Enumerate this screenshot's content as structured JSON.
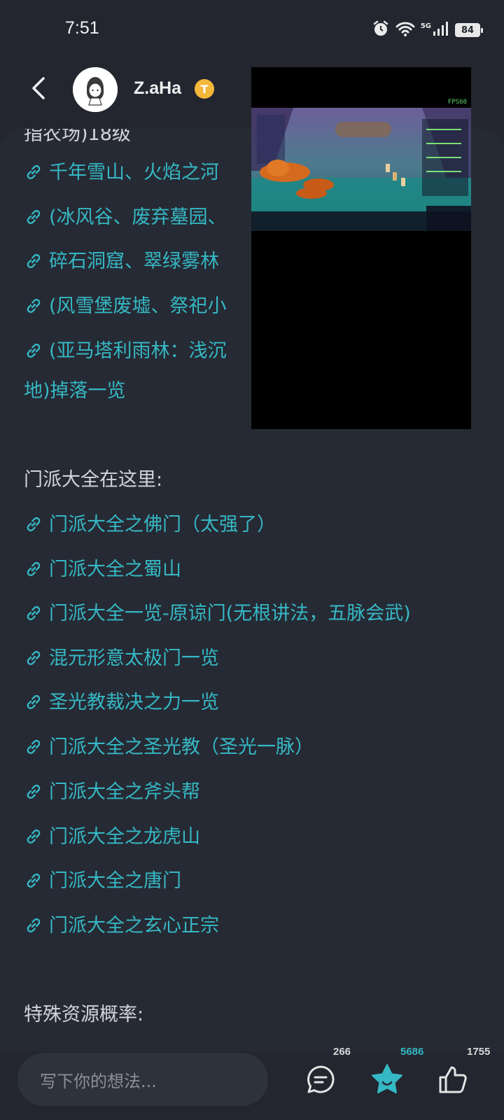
{
  "status": {
    "time": "7:51",
    "network": "5G",
    "battery": "84"
  },
  "header": {
    "username": "Z.aHa",
    "badge": "T"
  },
  "content": {
    "top_partial": "指农场)18级",
    "map_links": [
      "千年雪山、火焰之河",
      "(冰风谷、废弃墓园、",
      "碎石洞窟、翠绿雾林",
      "(风雪堡废墟、祭祀小",
      "(亚马塔利雨林：浅沉"
    ],
    "map_link_continuation": "地)掉落一览",
    "sect_heading": "门派大全在这里:",
    "sect_links": [
      "门派大全之佛门（太强了）",
      "门派大全之蜀山",
      "门派大全一览-原谅门(无根讲法，五脉会武)",
      "混元形意太极门一览",
      "圣光教裁决之力一览",
      "门派大全之圣光教（圣光一脉）",
      "门派大全之斧头帮",
      "门派大全之龙虎山",
      "门派大全之唐门",
      "门派大全之玄心正宗"
    ],
    "resource_heading": "特殊资源概率:"
  },
  "video": {
    "fps_label": "FPS60"
  },
  "bottom": {
    "comment_placeholder": "写下你的想法...",
    "comment_count": "266",
    "favorite_count": "5686",
    "like_count": "1755"
  },
  "colors": {
    "link": "#35b8c4",
    "background": "#23262f",
    "accent_star": "#35b8c4",
    "badge": "#f4b73a"
  }
}
